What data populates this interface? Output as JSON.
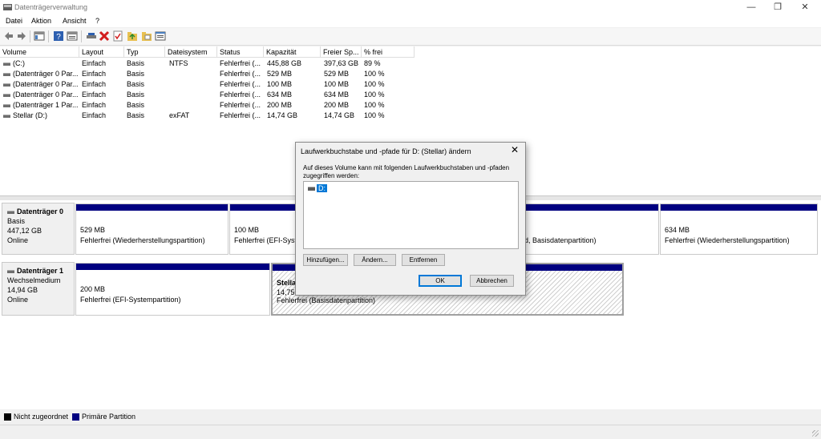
{
  "window": {
    "title": "Datenträgerverwaltung",
    "minimize": "—",
    "maximize": "❐",
    "close": "✕"
  },
  "menu": [
    "Datei",
    "Aktion",
    "Ansicht",
    "?"
  ],
  "toolbar": [
    "back-icon",
    "forward-icon",
    "console-tree-icon",
    "help-icon",
    "view-icon",
    "connect-icon",
    "delete-icon",
    "check-icon",
    "folder-up-icon",
    "folder-icon",
    "properties-icon"
  ],
  "columns": [
    "Volume",
    "Layout",
    "Typ",
    "Dateisystem",
    "Status",
    "Kapazität",
    "Freier Sp...",
    "% frei"
  ],
  "volumes": [
    {
      "volume": "(C:)",
      "layout": "Einfach",
      "typ": "Basis",
      "fs": "NTFS",
      "status": "Fehlerfrei (...",
      "cap": "445,88 GB",
      "free": "397,63 GB",
      "pct": "89 %"
    },
    {
      "volume": "(Datenträger 0 Par...",
      "layout": "Einfach",
      "typ": "Basis",
      "fs": "",
      "status": "Fehlerfrei (...",
      "cap": "529 MB",
      "free": "529 MB",
      "pct": "100 %"
    },
    {
      "volume": "(Datenträger 0 Par...",
      "layout": "Einfach",
      "typ": "Basis",
      "fs": "",
      "status": "Fehlerfrei (...",
      "cap": "100 MB",
      "free": "100 MB",
      "pct": "100 %"
    },
    {
      "volume": "(Datenträger 0 Par...",
      "layout": "Einfach",
      "typ": "Basis",
      "fs": "",
      "status": "Fehlerfrei (...",
      "cap": "634 MB",
      "free": "634 MB",
      "pct": "100 %"
    },
    {
      "volume": "(Datenträger 1 Par...",
      "layout": "Einfach",
      "typ": "Basis",
      "fs": "",
      "status": "Fehlerfrei (...",
      "cap": "200 MB",
      "free": "200 MB",
      "pct": "100 %"
    },
    {
      "volume": "Stellar (D:)",
      "layout": "Einfach",
      "typ": "Basis",
      "fs": "exFAT",
      "status": "Fehlerfrei (...",
      "cap": "14,74 GB",
      "free": "14,74 GB",
      "pct": "100 %"
    }
  ],
  "disk0": {
    "name": "Datenträger 0",
    "type": "Basis",
    "size": "447,12 GB",
    "state": "Online",
    "parts": [
      {
        "size": "529 MB",
        "status": "Fehlerfrei (Wiederherstellungspartition)"
      },
      {
        "size": "100 MB",
        "status": "Fehlerfrei (EFI-Syste"
      },
      {
        "size": "",
        "status": "ild, Basisdatenpartition)"
      },
      {
        "size": "634 MB",
        "status": "Fehlerfrei (Wiederherstellungspartition)"
      }
    ]
  },
  "disk1": {
    "name": "Datenträger 1",
    "type": "Wechselmedium",
    "size": "14,94 GB",
    "state": "Online",
    "parts": [
      {
        "size": "200 MB",
        "status": "Fehlerfrei (EFI-Systempartition)"
      },
      {
        "name": "Stellar",
        "size": "14,75 G",
        "status": "Fehlerfrei (Basisdatenpartition)"
      }
    ]
  },
  "legend": {
    "unallocated": "Nicht zugeordnet",
    "primary": "Primäre Partition",
    "unallocated_color": "#000000",
    "primary_color": "#000080"
  },
  "dialog": {
    "title": "Laufwerkbuchstabe und -pfade für D: (Stellar) ändern",
    "close": "✕",
    "description": "Auf dieses Volume kann mit folgenden Laufwerkbuchstaben und -pfaden zugegriffen werden:",
    "items": [
      "D:"
    ],
    "add": "Hinzufügen...",
    "change": "Ändern...",
    "remove": "Entfernen",
    "ok": "OK",
    "cancel": "Abbrechen"
  },
  "colors": {
    "accent": "#0078d7",
    "partition_bar": "#000080"
  }
}
